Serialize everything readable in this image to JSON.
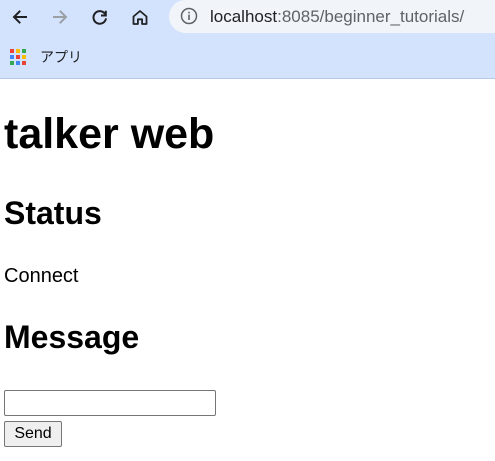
{
  "browser": {
    "url_host": "localhost",
    "url_path": ":8085/beginner_tutorials/",
    "bookmark_apps_label": "アプリ",
    "icons": {
      "back": "arrow-left-icon",
      "forward": "arrow-right-icon",
      "reload": "reload-icon",
      "home": "home-icon",
      "site_info": "info-icon",
      "apps": "apps-grid-icon"
    },
    "colors": {
      "chrome_background": "#d3e3fd",
      "omnibox_background": "#f1f4f9",
      "forward_disabled": "#9aa0a6"
    }
  },
  "page": {
    "title": "talker web",
    "status_heading": "Status",
    "status_text": "Connect",
    "message_heading": "Message",
    "message_input": {
      "value": "",
      "placeholder": ""
    },
    "send_label": "Send"
  }
}
